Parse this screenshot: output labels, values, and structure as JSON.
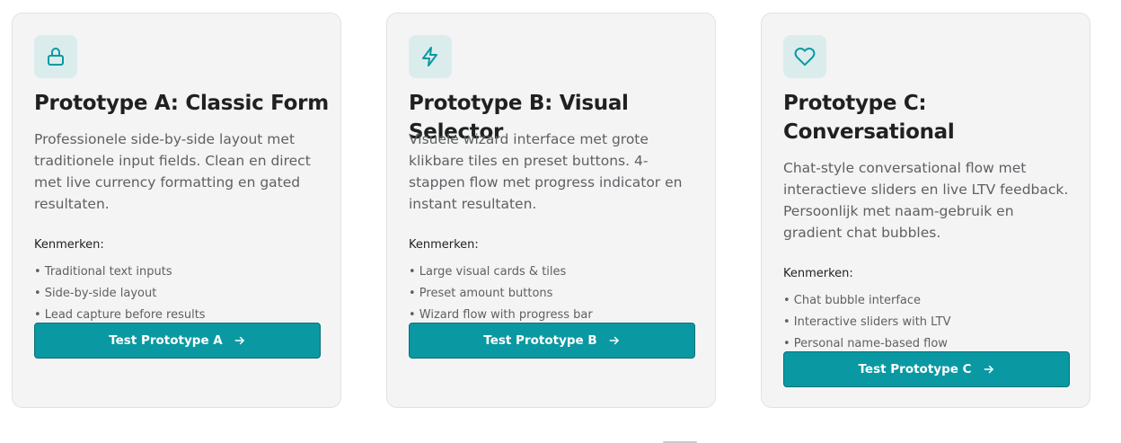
{
  "cards": [
    {
      "icon": "lock-icon",
      "title": "Prototype A: Classic Form",
      "description": "Professionele side-by-side layout met traditionele input fields. Clean en direct met live currency formatting en gated resultaten.",
      "features_label": "Kenmerken:",
      "features": [
        "• Traditional text inputs",
        "• Side-by-side layout",
        "• Lead capture before results"
      ],
      "button_label": "Test Prototype A"
    },
    {
      "icon": "lightning-icon",
      "title": "Prototype B: Visual Selector",
      "description": "Visuele wizard interface met grote klikbare tiles en preset buttons. 4-stappen flow met progress indicator en instant resultaten.",
      "features_label": "Kenmerken:",
      "features": [
        "• Large visual cards & tiles",
        "• Preset amount buttons",
        "• Wizard flow with progress bar"
      ],
      "button_label": "Test Prototype B"
    },
    {
      "icon": "heart-icon",
      "title": "Prototype C: Conversational",
      "description": "Chat-style conversational flow met interactieve sliders en live LTV feedback. Persoonlijk met naam-gebruik en gradient chat bubbles.",
      "features_label": "Kenmerken:",
      "features": [
        "• Chat bubble interface",
        "• Interactive sliders with LTV",
        "• Personal name-based flow"
      ],
      "button_label": "Test Prototype C"
    }
  ],
  "colors": {
    "accent": "#0a99a3",
    "icon_bg": "#dbeced",
    "card_bg": "#f4f4f5"
  }
}
